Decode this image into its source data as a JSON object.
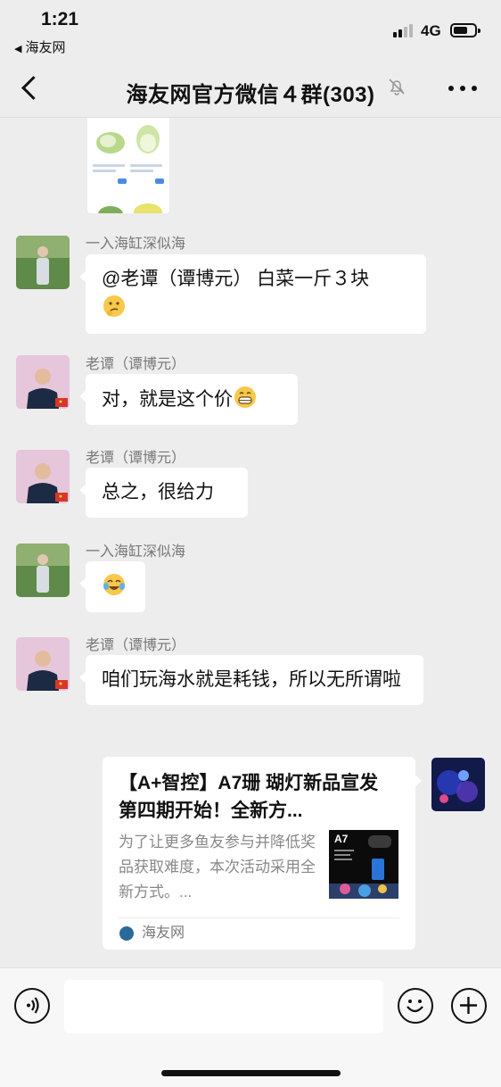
{
  "status_bar": {
    "time": "1:21",
    "back_app": "海友网",
    "network": "4G",
    "battery_level": 0.7,
    "signal_bars": 2
  },
  "nav": {
    "title": "海友网官方微信４群(303)",
    "back_icon": "chevron-left-icon",
    "mute_icon": "bell-slash-icon",
    "more_icon": "ellipsis-icon"
  },
  "messages": [
    {
      "sender": "一入海缸深似海",
      "text": "@老谭（谭博元） 白菜一斤３块",
      "emoji": "thinking-face-icon"
    },
    {
      "sender": "老谭（谭博元）",
      "text": "对，就是这个价",
      "emoji": "grinning-face-icon"
    },
    {
      "sender": "老谭（谭博元）",
      "text": "总之，很给力"
    },
    {
      "sender": "一入海缸深似海",
      "text": "",
      "emoji": "tears-of-joy-icon"
    },
    {
      "sender": "老谭（谭博元）",
      "text": "咱们玩海水就是耗钱，所以无所谓啦"
    }
  ],
  "link_card": {
    "title": "【A+智控】A7珊 瑚灯新品宣发第四期开始！全新方...",
    "description": "为了让更多鱼友参与并降低奖品获取难度，本次活动采用全新方式。...",
    "thumb_text": "A7",
    "source": "海友网"
  },
  "input_bar": {
    "voice_icon": "voice-icon",
    "emoji_icon": "emoji-icon",
    "plus_icon": "plus-icon"
  }
}
